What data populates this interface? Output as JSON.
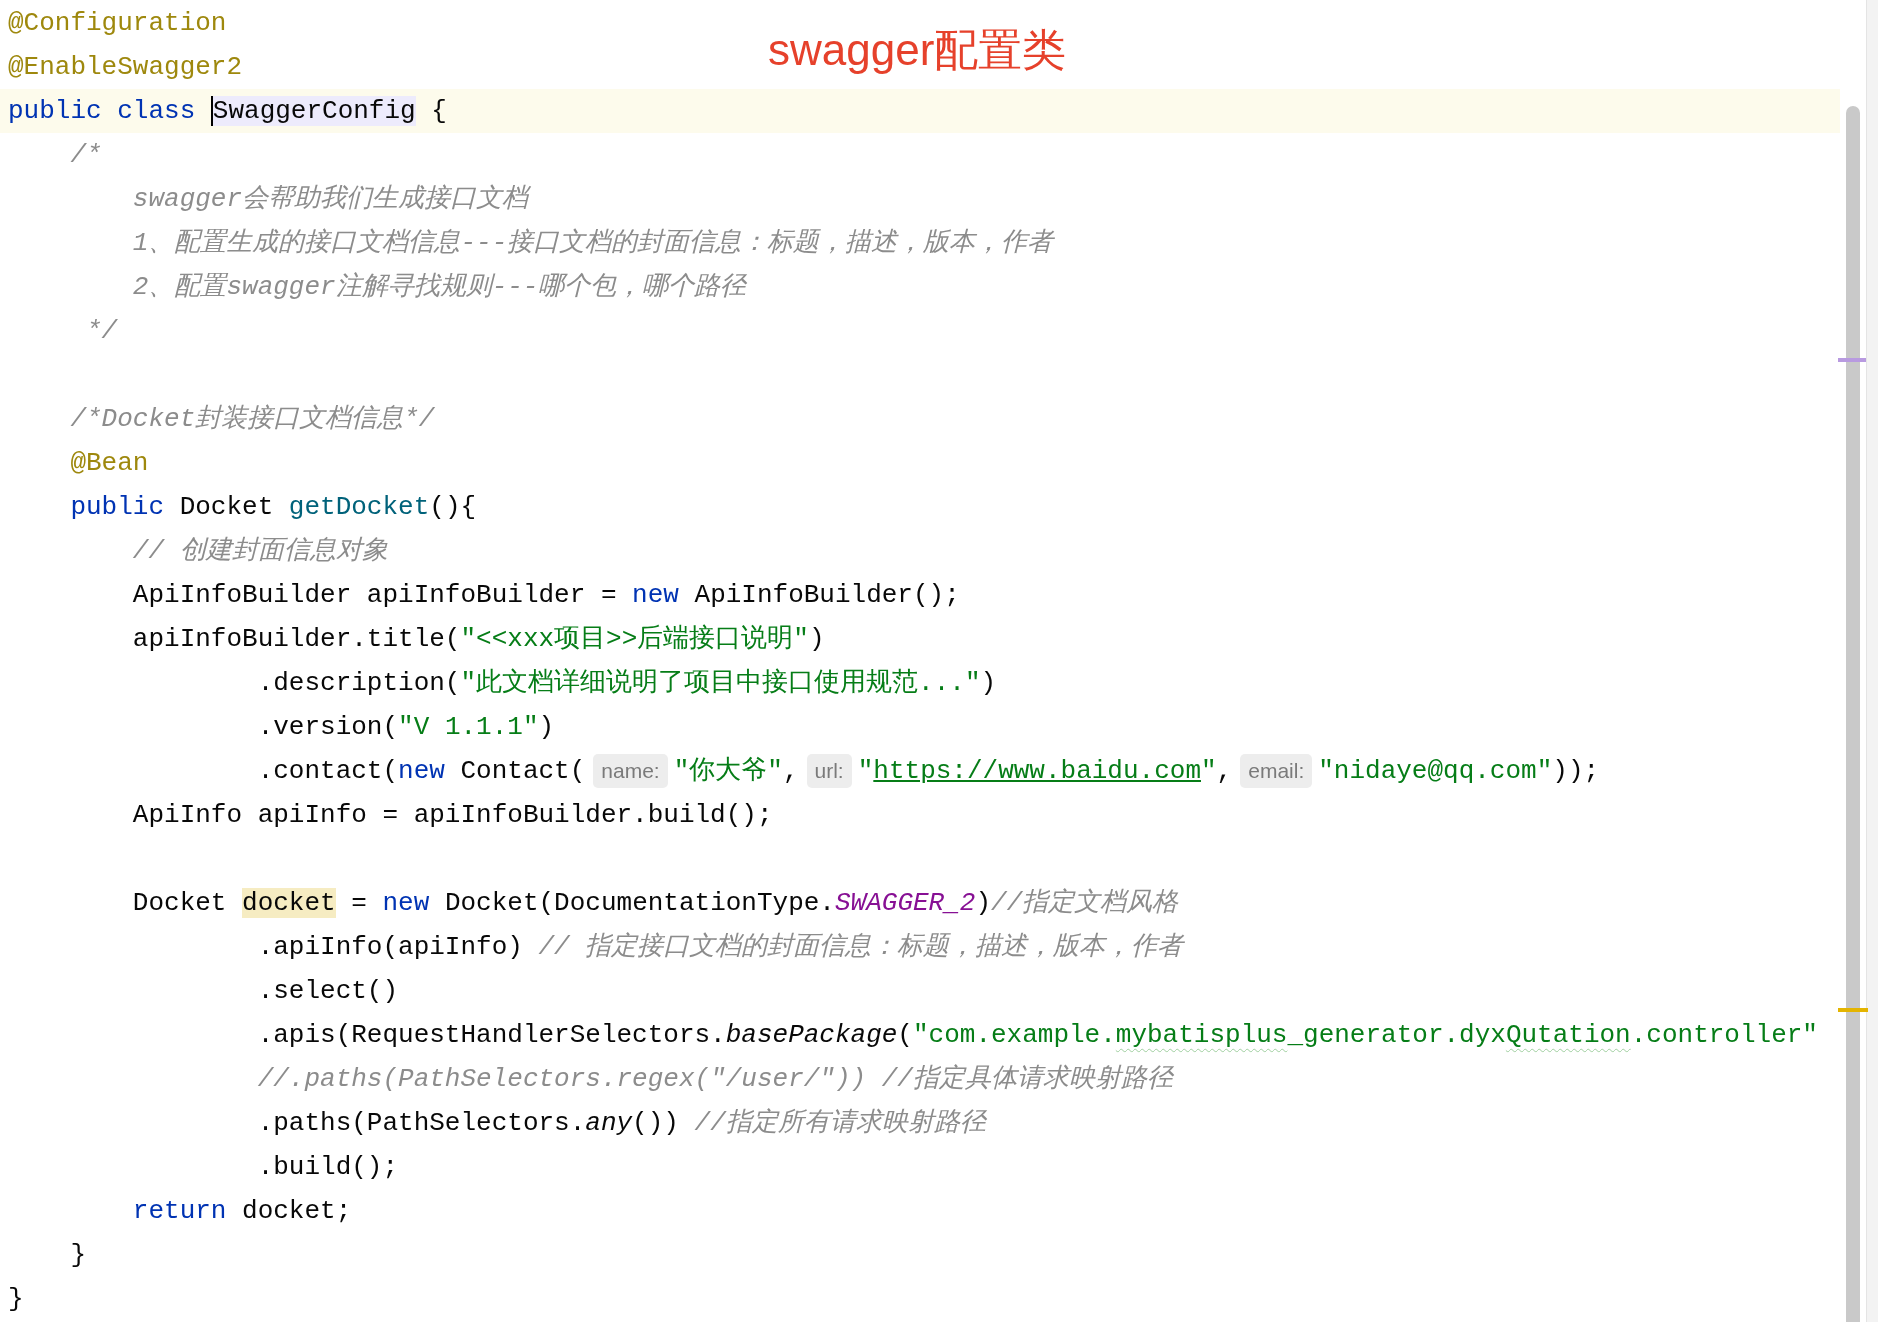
{
  "annotation": {
    "text": "swagger配置类"
  },
  "editor": {
    "lines": [
      {
        "current": false,
        "segments": [
          {
            "kind": "code",
            "tokens": [
              {
                "kind": "annotation",
                "text": "@Configuration"
              }
            ]
          }
        ]
      },
      {
        "current": false,
        "segments": [
          {
            "kind": "code",
            "tokens": [
              {
                "kind": "annotation",
                "text": "@EnableSwagger2"
              }
            ]
          }
        ]
      },
      {
        "current": true,
        "segments": [
          {
            "kind": "code",
            "tokens": [
              {
                "kind": "keyword",
                "text": "public class "
              },
              {
                "kind": "plain",
                "text": "SwaggerConfig",
                "identifier_highlight": true,
                "caret": true
              },
              {
                "kind": "plain",
                "text": " {"
              }
            ]
          }
        ]
      },
      {
        "current": false,
        "segments": [
          {
            "kind": "code",
            "tokens": [
              {
                "kind": "comment",
                "text": "    /*"
              }
            ]
          }
        ]
      },
      {
        "current": false,
        "segments": [
          {
            "kind": "code",
            "tokens": [
              {
                "kind": "comment",
                "text": "        swagger会帮助我们生成接口文档"
              }
            ]
          }
        ]
      },
      {
        "current": false,
        "segments": [
          {
            "kind": "code",
            "tokens": [
              {
                "kind": "comment",
                "text": "        1、配置生成的接口文档信息---接口文档的封面信息：标题，描述，版本，作者"
              }
            ]
          }
        ]
      },
      {
        "current": false,
        "segments": [
          {
            "kind": "code",
            "tokens": [
              {
                "kind": "comment",
                "text": "        2、配置swagger注解寻找规则---哪个包，哪个路径"
              }
            ]
          }
        ]
      },
      {
        "current": false,
        "segments": [
          {
            "kind": "code",
            "tokens": [
              {
                "kind": "comment",
                "text": "     */"
              }
            ]
          }
        ]
      },
      {
        "current": false
      },
      {
        "current": false,
        "segments": [
          {
            "kind": "code",
            "tokens": [
              {
                "kind": "comment",
                "text": "    /*Docket封装接口文档信息*/"
              }
            ]
          }
        ]
      },
      {
        "current": false,
        "segments": [
          {
            "kind": "code",
            "tokens": [
              {
                "kind": "annotation",
                "text": "    @Bean"
              }
            ]
          }
        ]
      },
      {
        "current": false,
        "segments": [
          {
            "kind": "code",
            "tokens": [
              {
                "kind": "keyword",
                "text": "    public "
              },
              {
                "kind": "plain",
                "text": "Docket "
              },
              {
                "kind": "method",
                "text": "getDocket"
              },
              {
                "kind": "plain",
                "text": "(){"
              }
            ]
          }
        ]
      },
      {
        "current": false,
        "segments": [
          {
            "kind": "code",
            "tokens": [
              {
                "kind": "comment",
                "text": "        // 创建封面信息对象"
              }
            ]
          }
        ]
      },
      {
        "current": false,
        "segments": [
          {
            "kind": "code",
            "tokens": [
              {
                "kind": "plain",
                "text": "        ApiInfoBuilder apiInfoBuilder = "
              },
              {
                "kind": "keyword",
                "text": "new "
              },
              {
                "kind": "plain",
                "text": "ApiInfoBuilder();"
              }
            ]
          }
        ]
      },
      {
        "current": false,
        "segments": [
          {
            "kind": "code",
            "tokens": [
              {
                "kind": "plain",
                "text": "        apiInfoBuilder.title("
              },
              {
                "kind": "string",
                "text": "\"<<xxx项目>>后端接口说明\""
              },
              {
                "kind": "plain",
                "text": ")"
              }
            ]
          }
        ]
      },
      {
        "current": false,
        "segments": [
          {
            "kind": "code",
            "tokens": [
              {
                "kind": "plain",
                "text": "                .description("
              },
              {
                "kind": "string",
                "text": "\"此文档详细说明了项目中接口使用规范...\""
              },
              {
                "kind": "plain",
                "text": ")"
              }
            ]
          }
        ]
      },
      {
        "current": false,
        "segments": [
          {
            "kind": "code",
            "tokens": [
              {
                "kind": "plain",
                "text": "                .version("
              },
              {
                "kind": "string",
                "text": "\"V 1.1.1\""
              },
              {
                "kind": "plain",
                "text": ")"
              }
            ]
          }
        ]
      },
      {
        "current": false,
        "segments": [
          {
            "kind": "code",
            "tokens": [
              {
                "kind": "plain",
                "text": "                .contact("
              },
              {
                "kind": "keyword",
                "text": "new "
              },
              {
                "kind": "plain",
                "text": "Contact("
              }
            ]
          },
          {
            "kind": "hint",
            "text": "name:"
          },
          {
            "kind": "code",
            "tokens": [
              {
                "kind": "string",
                "text": "\"你大爷\""
              },
              {
                "kind": "plain",
                "text": ","
              }
            ]
          },
          {
            "kind": "hint",
            "text": "url:"
          },
          {
            "kind": "code",
            "tokens": [
              {
                "kind": "string",
                "text": "\""
              },
              {
                "kind": "link",
                "text": "https://www.baidu.com"
              },
              {
                "kind": "string",
                "text": "\""
              },
              {
                "kind": "plain",
                "text": ","
              }
            ]
          },
          {
            "kind": "hint",
            "text": "email:"
          },
          {
            "kind": "code",
            "tokens": [
              {
                "kind": "string",
                "text": "\"nidaye@qq.com\""
              },
              {
                "kind": "plain",
                "text": "));"
              }
            ]
          }
        ]
      },
      {
        "current": false,
        "segments": [
          {
            "kind": "code",
            "tokens": [
              {
                "kind": "plain",
                "text": "        ApiInfo apiInfo = apiInfoBuilder.build();"
              }
            ]
          }
        ]
      },
      {
        "current": false
      },
      {
        "current": false,
        "segments": [
          {
            "kind": "code",
            "tokens": [
              {
                "kind": "plain",
                "text": "        Docket "
              },
              {
                "kind": "plain",
                "text": "docket",
                "usage_highlight": true
              },
              {
                "kind": "plain",
                "text": " = "
              },
              {
                "kind": "keyword",
                "text": "new "
              },
              {
                "kind": "plain",
                "text": "Docket(DocumentationType."
              },
              {
                "kind": "constant",
                "text": "SWAGGER_2"
              },
              {
                "kind": "plain",
                "text": ")"
              },
              {
                "kind": "comment",
                "text": "//指定文档风格"
              }
            ]
          }
        ]
      },
      {
        "current": false,
        "segments": [
          {
            "kind": "code",
            "tokens": [
              {
                "kind": "plain",
                "text": "                .apiInfo(apiInfo) "
              },
              {
                "kind": "comment",
                "text": "// 指定接口文档的封面信息：标题，描述，版本，作者"
              }
            ]
          }
        ]
      },
      {
        "current": false,
        "segments": [
          {
            "kind": "code",
            "tokens": [
              {
                "kind": "plain",
                "text": "                .select()"
              }
            ]
          }
        ]
      },
      {
        "current": false,
        "segments": [
          {
            "kind": "code",
            "tokens": [
              {
                "kind": "plain",
                "text": "                .apis(RequestHandlerSelectors."
              },
              {
                "kind": "static",
                "text": "basePackage"
              },
              {
                "kind": "plain",
                "text": "("
              },
              {
                "kind": "string",
                "text": "\"com.example."
              },
              {
                "kind": "string",
                "text": "mybatisplus",
                "typo": true
              },
              {
                "kind": "string",
                "text": "_generator.dyx"
              },
              {
                "kind": "string",
                "text": "Qutation",
                "typo": true
              },
              {
                "kind": "string",
                "text": ".controller\""
              }
            ]
          }
        ]
      },
      {
        "current": false,
        "segments": [
          {
            "kind": "code",
            "tokens": [
              {
                "kind": "comment",
                "text": "                //.paths(PathSelectors.regex(\"/user/\")) //指定具体请求映射路径"
              }
            ]
          }
        ]
      },
      {
        "current": false,
        "segments": [
          {
            "kind": "code",
            "tokens": [
              {
                "kind": "plain",
                "text": "                .paths(PathSelectors."
              },
              {
                "kind": "static",
                "text": "any"
              },
              {
                "kind": "plain",
                "text": "()) "
              },
              {
                "kind": "comment",
                "text": "//指定所有请求映射路径"
              }
            ]
          }
        ]
      },
      {
        "current": false,
        "segments": [
          {
            "kind": "code",
            "tokens": [
              {
                "kind": "plain",
                "text": "                .build();"
              }
            ]
          }
        ]
      },
      {
        "current": false,
        "segments": [
          {
            "kind": "code",
            "tokens": [
              {
                "kind": "keyword",
                "text": "        return "
              },
              {
                "kind": "plain",
                "text": "docket;"
              }
            ]
          }
        ]
      },
      {
        "current": false,
        "segments": [
          {
            "kind": "code",
            "tokens": [
              {
                "kind": "plain",
                "text": "    }"
              }
            ]
          }
        ]
      },
      {
        "current": false,
        "segments": [
          {
            "kind": "code",
            "tokens": [
              {
                "kind": "plain",
                "text": "}"
              }
            ]
          }
        ]
      }
    ]
  }
}
